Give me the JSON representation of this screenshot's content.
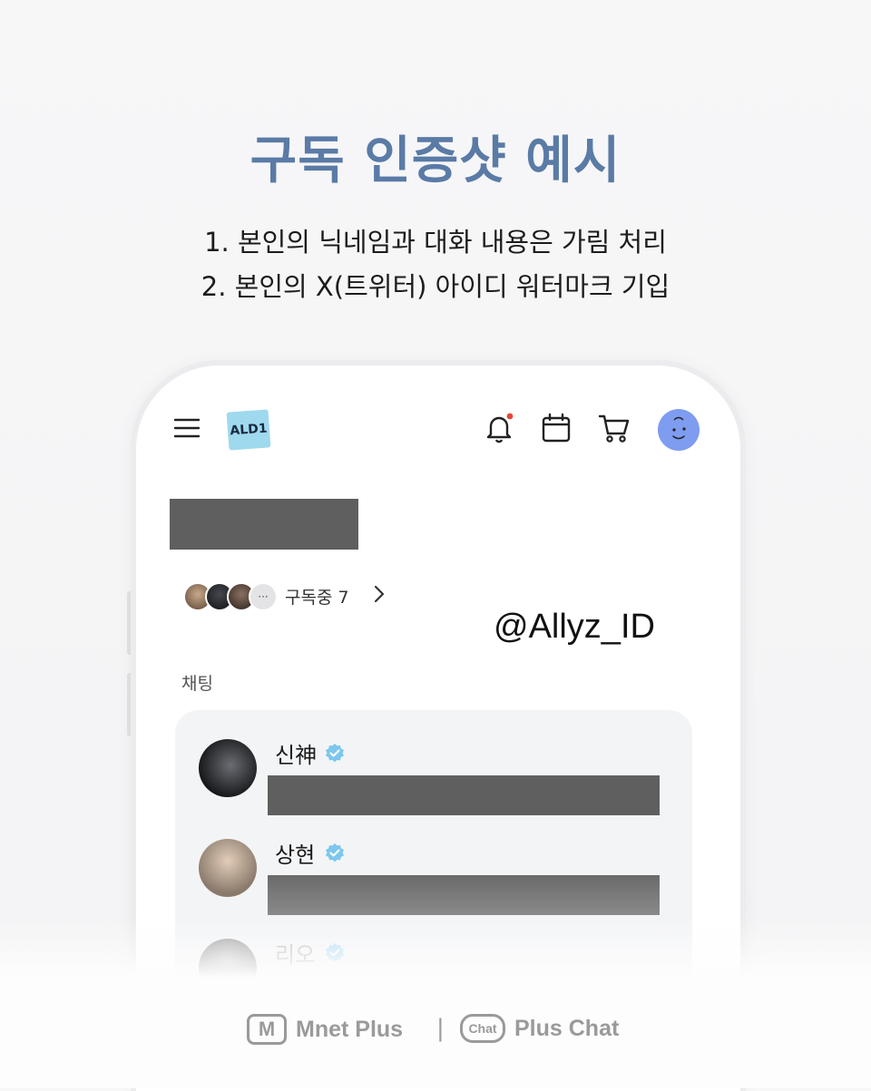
{
  "colors": {
    "title": "#5a7ba6",
    "redaction": "#5f5f5f",
    "verified": "#7cc7ee",
    "avatar_blue": "#7e9cf0",
    "notification_dot": "#e8453c"
  },
  "header": {
    "title": "구독 인증샷 예시",
    "rules": [
      "1. 본인의 닉네임과 대화 내용은 가림 처리",
      "2. 본인의 X(트위터) 아이디 워터마크 기입"
    ]
  },
  "app": {
    "logo_text": "ALD1",
    "icons": [
      "menu-icon",
      "bell-icon",
      "calendar-icon",
      "cart-icon",
      "profile-avatar"
    ],
    "subscription": {
      "label": "구독중 7",
      "more_symbol": "···"
    },
    "watermark": "@Allyz_ID",
    "section_label": "채팅",
    "chats": [
      {
        "name": "신神",
        "verified": true
      },
      {
        "name": "상현",
        "verified": true
      },
      {
        "name": "리오",
        "verified": true
      }
    ]
  },
  "footer": {
    "brand1_badge": "M",
    "brand1": "Mnet Plus",
    "separator": "|",
    "brand2_badge": "Chat",
    "brand2": "Plus Chat"
  }
}
